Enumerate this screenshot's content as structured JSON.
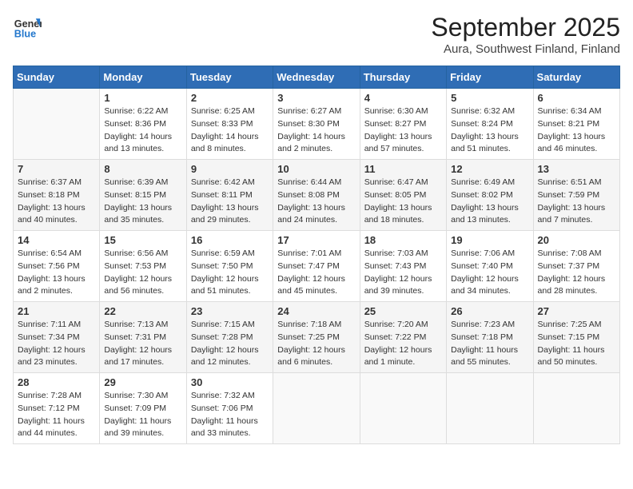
{
  "header": {
    "logo_general": "General",
    "logo_blue": "Blue",
    "month_title": "September 2025",
    "subtitle": "Aura, Southwest Finland, Finland"
  },
  "weekdays": [
    "Sunday",
    "Monday",
    "Tuesday",
    "Wednesday",
    "Thursday",
    "Friday",
    "Saturday"
  ],
  "weeks": [
    [
      {
        "day": "",
        "info": ""
      },
      {
        "day": "1",
        "info": "Sunrise: 6:22 AM\nSunset: 8:36 PM\nDaylight: 14 hours\nand 13 minutes."
      },
      {
        "day": "2",
        "info": "Sunrise: 6:25 AM\nSunset: 8:33 PM\nDaylight: 14 hours\nand 8 minutes."
      },
      {
        "day": "3",
        "info": "Sunrise: 6:27 AM\nSunset: 8:30 PM\nDaylight: 14 hours\nand 2 minutes."
      },
      {
        "day": "4",
        "info": "Sunrise: 6:30 AM\nSunset: 8:27 PM\nDaylight: 13 hours\nand 57 minutes."
      },
      {
        "day": "5",
        "info": "Sunrise: 6:32 AM\nSunset: 8:24 PM\nDaylight: 13 hours\nand 51 minutes."
      },
      {
        "day": "6",
        "info": "Sunrise: 6:34 AM\nSunset: 8:21 PM\nDaylight: 13 hours\nand 46 minutes."
      }
    ],
    [
      {
        "day": "7",
        "info": "Sunrise: 6:37 AM\nSunset: 8:18 PM\nDaylight: 13 hours\nand 40 minutes."
      },
      {
        "day": "8",
        "info": "Sunrise: 6:39 AM\nSunset: 8:15 PM\nDaylight: 13 hours\nand 35 minutes."
      },
      {
        "day": "9",
        "info": "Sunrise: 6:42 AM\nSunset: 8:11 PM\nDaylight: 13 hours\nand 29 minutes."
      },
      {
        "day": "10",
        "info": "Sunrise: 6:44 AM\nSunset: 8:08 PM\nDaylight: 13 hours\nand 24 minutes."
      },
      {
        "day": "11",
        "info": "Sunrise: 6:47 AM\nSunset: 8:05 PM\nDaylight: 13 hours\nand 18 minutes."
      },
      {
        "day": "12",
        "info": "Sunrise: 6:49 AM\nSunset: 8:02 PM\nDaylight: 13 hours\nand 13 minutes."
      },
      {
        "day": "13",
        "info": "Sunrise: 6:51 AM\nSunset: 7:59 PM\nDaylight: 13 hours\nand 7 minutes."
      }
    ],
    [
      {
        "day": "14",
        "info": "Sunrise: 6:54 AM\nSunset: 7:56 PM\nDaylight: 13 hours\nand 2 minutes."
      },
      {
        "day": "15",
        "info": "Sunrise: 6:56 AM\nSunset: 7:53 PM\nDaylight: 12 hours\nand 56 minutes."
      },
      {
        "day": "16",
        "info": "Sunrise: 6:59 AM\nSunset: 7:50 PM\nDaylight: 12 hours\nand 51 minutes."
      },
      {
        "day": "17",
        "info": "Sunrise: 7:01 AM\nSunset: 7:47 PM\nDaylight: 12 hours\nand 45 minutes."
      },
      {
        "day": "18",
        "info": "Sunrise: 7:03 AM\nSunset: 7:43 PM\nDaylight: 12 hours\nand 39 minutes."
      },
      {
        "day": "19",
        "info": "Sunrise: 7:06 AM\nSunset: 7:40 PM\nDaylight: 12 hours\nand 34 minutes."
      },
      {
        "day": "20",
        "info": "Sunrise: 7:08 AM\nSunset: 7:37 PM\nDaylight: 12 hours\nand 28 minutes."
      }
    ],
    [
      {
        "day": "21",
        "info": "Sunrise: 7:11 AM\nSunset: 7:34 PM\nDaylight: 12 hours\nand 23 minutes."
      },
      {
        "day": "22",
        "info": "Sunrise: 7:13 AM\nSunset: 7:31 PM\nDaylight: 12 hours\nand 17 minutes."
      },
      {
        "day": "23",
        "info": "Sunrise: 7:15 AM\nSunset: 7:28 PM\nDaylight: 12 hours\nand 12 minutes."
      },
      {
        "day": "24",
        "info": "Sunrise: 7:18 AM\nSunset: 7:25 PM\nDaylight: 12 hours\nand 6 minutes."
      },
      {
        "day": "25",
        "info": "Sunrise: 7:20 AM\nSunset: 7:22 PM\nDaylight: 12 hours\nand 1 minute."
      },
      {
        "day": "26",
        "info": "Sunrise: 7:23 AM\nSunset: 7:18 PM\nDaylight: 11 hours\nand 55 minutes."
      },
      {
        "day": "27",
        "info": "Sunrise: 7:25 AM\nSunset: 7:15 PM\nDaylight: 11 hours\nand 50 minutes."
      }
    ],
    [
      {
        "day": "28",
        "info": "Sunrise: 7:28 AM\nSunset: 7:12 PM\nDaylight: 11 hours\nand 44 minutes."
      },
      {
        "day": "29",
        "info": "Sunrise: 7:30 AM\nSunset: 7:09 PM\nDaylight: 11 hours\nand 39 minutes."
      },
      {
        "day": "30",
        "info": "Sunrise: 7:32 AM\nSunset: 7:06 PM\nDaylight: 11 hours\nand 33 minutes."
      },
      {
        "day": "",
        "info": ""
      },
      {
        "day": "",
        "info": ""
      },
      {
        "day": "",
        "info": ""
      },
      {
        "day": "",
        "info": ""
      }
    ]
  ]
}
